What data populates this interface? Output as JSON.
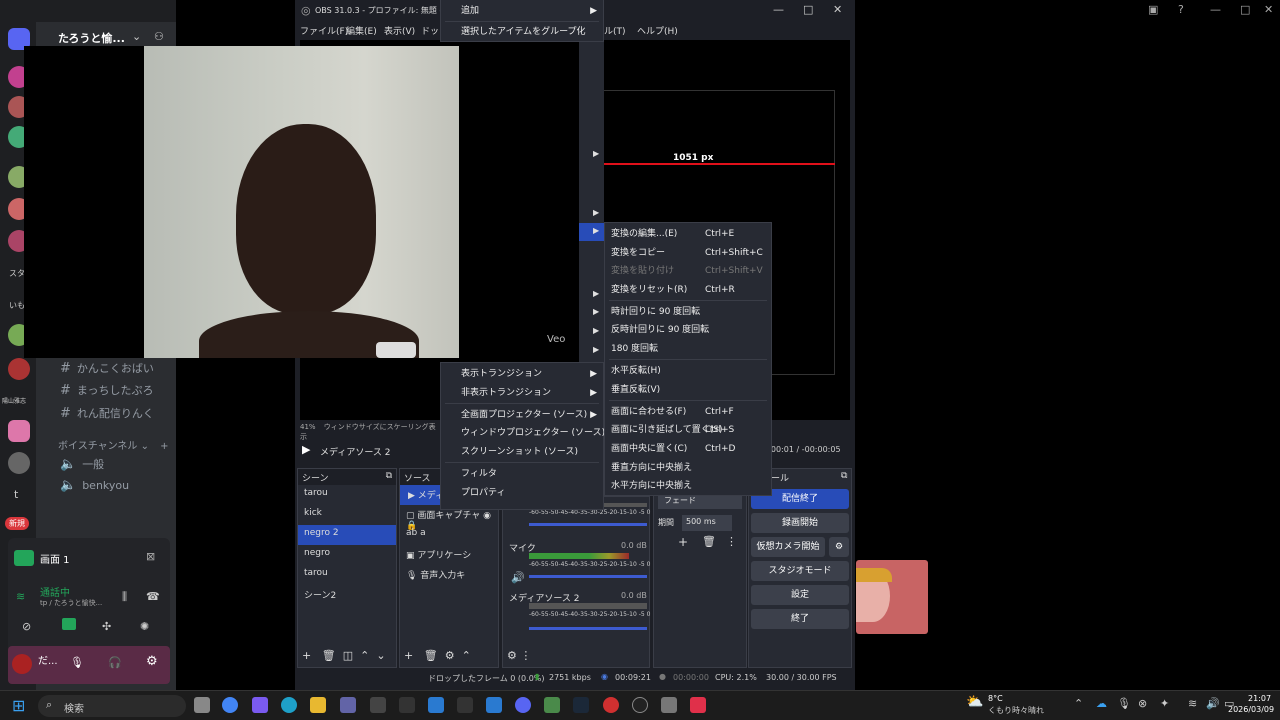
{
  "discord": {
    "server_name": "たろうと愉...",
    "channels": [
      "かんこくおばい",
      "まっちしたぷろ",
      "れん配信りんく"
    ],
    "voice_header": "ボイスチャンネル",
    "voice_channels": [
      "一般",
      "benkyou"
    ],
    "new_badge": "新規",
    "stream_title": "画面 1",
    "call_status": "通話中",
    "call_sub": "tp / たろうと愉快...",
    "user_name": "だ...",
    "server_labels": [
      "スタ",
      "いも",
      "陽山雅志",
      "t"
    ]
  },
  "obs": {
    "title": "OBS 31.0.3 - プロファイル: 無題 - シーン",
    "menu": [
      "ファイル(F)",
      "編集(E)",
      "表示(V)",
      "ドッ",
      "ール(T)",
      "ヘルプ(H)"
    ],
    "preview_label": "1051 px",
    "cam_watermark": "Veo",
    "status_left": "41%",
    "status_left2": "ウィンドウサイズにスケーリング表示",
    "media_source": "メディアソース 2",
    "timecode": "00:00:01 / -00:00:05",
    "scenes_header": "シーン",
    "sources_header": "ソース",
    "scenes": [
      "tarou",
      "kick",
      "negro 2",
      "negro",
      "tarou",
      "シーン2"
    ],
    "selected_scene": "negro 2",
    "sources": [
      "メディア",
      "画面キャプチャ",
      "a",
      "アプリケーシ",
      "音声入力キ"
    ],
    "mixer": [
      {
        "name": "",
        "db": ""
      },
      {
        "name": "マイク",
        "db": "0.0 dB"
      },
      {
        "name": "メディアソース 2",
        "db": "0.0 dB"
      }
    ],
    "meter_ticks": "-60-55-50-45-40-35-30-25-20-15-10 -5 0",
    "transition": "フェード",
    "duration_label": "期間",
    "duration_value": "500 ms",
    "controls_header": "ール",
    "controls": [
      "配信終了",
      "録画開始",
      "仮想カメラ開始",
      "スタジオモード",
      "設定",
      "終了"
    ],
    "statusbar": {
      "dropped": "ドロップしたフレーム 0 (0.0%)",
      "bitrate": "2751 kbps",
      "stream_time": "00:09:21",
      "rec_time": "00:00:00",
      "cpu": "CPU: 2.1%",
      "fps": "30.00 / 30.00 FPS"
    }
  },
  "menu1": {
    "items": [
      {
        "label": "追加",
        "arrow": true
      },
      {
        "label": "選択したアイテムをグループ化"
      },
      {
        "label": "表示トランジション",
        "arrow": true
      },
      {
        "label": "非表示トランジション",
        "arrow": true
      },
      {
        "label": "全画面プロジェクター (ソース)",
        "arrow": true
      },
      {
        "label": "ウィンドウプロジェクター (ソース)"
      },
      {
        "label": "スクリーンショット (ソース)"
      },
      {
        "label": "フィルタ"
      },
      {
        "label": "プロパティ"
      }
    ]
  },
  "menu2": {
    "items": [
      {
        "label": "変換の編集...(E)",
        "shortcut": "Ctrl+E"
      },
      {
        "label": "変換をコピー",
        "shortcut": "Ctrl+Shift+C"
      },
      {
        "label": "変換を貼り付け",
        "shortcut": "Ctrl+Shift+V",
        "disabled": true
      },
      {
        "label": "変換をリセット(R)",
        "shortcut": "Ctrl+R"
      },
      {
        "label": "時計回りに 90 度回転"
      },
      {
        "label": "反時計回りに 90 度回転"
      },
      {
        "label": "180 度回転"
      },
      {
        "label": "水平反転(H)"
      },
      {
        "label": "垂直反転(V)"
      },
      {
        "label": "画面に合わせる(F)",
        "shortcut": "Ctrl+F"
      },
      {
        "label": "画面に引き延ばして置く(S)",
        "shortcut": "Ctrl+S"
      },
      {
        "label": "画面中央に置く(C)",
        "shortcut": "Ctrl+D"
      },
      {
        "label": "垂直方向に中央揃え"
      },
      {
        "label": "水平方向に中央揃え"
      }
    ]
  },
  "taskbar": {
    "search": "検索",
    "weather_temp": "8°C",
    "weather_desc": "くもり時々晴れ",
    "time": "21:07",
    "date": "2026/03/09"
  }
}
